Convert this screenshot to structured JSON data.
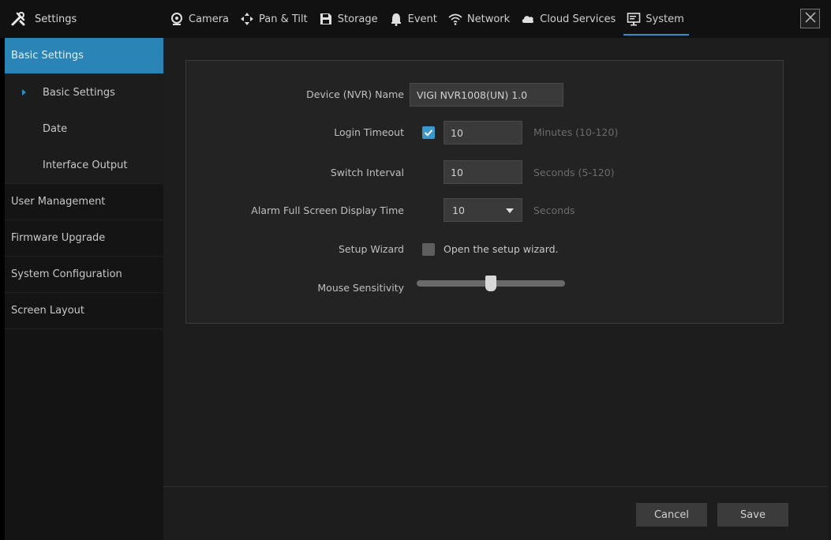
{
  "header": {
    "title": "Settings",
    "tabs": [
      {
        "label": "Camera",
        "icon": "camera-icon"
      },
      {
        "label": "Pan & Tilt",
        "icon": "pan-tilt-icon"
      },
      {
        "label": "Storage",
        "icon": "storage-icon"
      },
      {
        "label": "Event",
        "icon": "bell-icon"
      },
      {
        "label": "Network",
        "icon": "wifi-icon"
      },
      {
        "label": "Cloud Services",
        "icon": "cloud-icon"
      },
      {
        "label": "System",
        "icon": "monitor-icon",
        "active": true
      }
    ]
  },
  "sidebar": {
    "items": [
      {
        "label": "Basic Settings",
        "active": true
      },
      {
        "label": "User Management"
      },
      {
        "label": "Firmware Upgrade"
      },
      {
        "label": "System Configuration"
      },
      {
        "label": "Screen Layout"
      }
    ],
    "sub_items": [
      {
        "label": "Basic Settings",
        "current": true
      },
      {
        "label": "Date"
      },
      {
        "label": "Interface Output"
      }
    ]
  },
  "form": {
    "device_name": {
      "label": "Device (NVR) Name",
      "value": "VIGI NVR1008(UN) 1.0"
    },
    "login_timeout": {
      "label": "Login Timeout",
      "enabled": true,
      "value": "10",
      "hint": "Minutes (10-120)"
    },
    "switch_interval": {
      "label": "Switch Interval",
      "value": "10",
      "hint": "Seconds (5-120)"
    },
    "alarm_display": {
      "label": "Alarm Full Screen Display Time",
      "value": "10",
      "hint": "Seconds"
    },
    "setup_wizard": {
      "label": "Setup Wizard",
      "enabled": false,
      "text": "Open the setup wizard."
    },
    "mouse_sensitivity": {
      "label": "Mouse Sensitivity",
      "level": 0.5
    }
  },
  "footer": {
    "cancel_label": "Cancel",
    "save_label": "Save"
  },
  "colors": {
    "accent": "#2a84b5",
    "checkbox_on": "#3a97cf"
  }
}
